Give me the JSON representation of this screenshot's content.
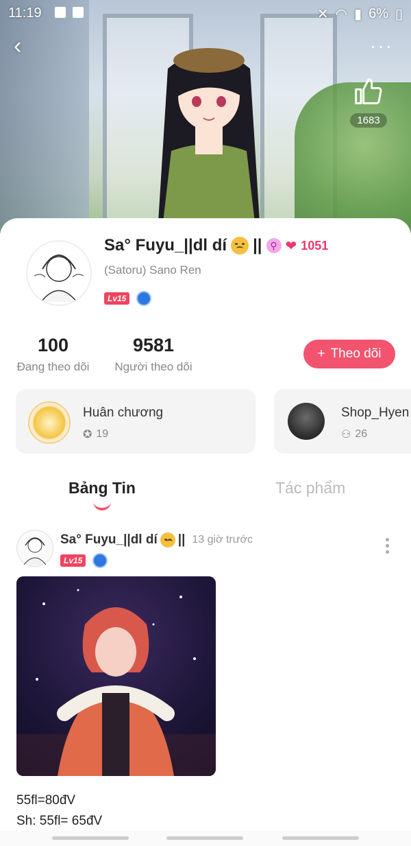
{
  "status_bar": {
    "time": "11:19",
    "battery": "6%"
  },
  "hero": {
    "like_count": "1683"
  },
  "profile": {
    "name": "Sa° Fuyu_||dl dí",
    "name_suffix": "||",
    "hearts": "1051",
    "subname": "(Satoru) Sano Ren",
    "level": "Lv15"
  },
  "stats": {
    "following": {
      "value": "100",
      "label": "Đang theo dõi"
    },
    "followers": {
      "value": "9581",
      "label": "Người theo dõi"
    }
  },
  "follow_button": {
    "label": "Theo dõi",
    "icon": "+"
  },
  "tiles": [
    {
      "title": "Huân chương",
      "sub": "19",
      "icon": "medal-icon"
    },
    {
      "title": "Shop_Hyen",
      "sub": "26",
      "icon": "people-icon"
    }
  ],
  "tabs": [
    {
      "label": "Bảng Tin",
      "active": true
    },
    {
      "label": "Tác phẩm",
      "active": false
    }
  ],
  "post": {
    "author": "Sa° Fuyu_||dl dí",
    "author_suffix": "||",
    "time": "13 giờ trước",
    "level": "Lv15",
    "text_lines": [
      "55fl=80đV",
      "Sh: 55fl= 65đV"
    ]
  },
  "colors": {
    "accent": "#f2536e",
    "level_tag": "#f0435f",
    "heart": "#f0366a"
  }
}
